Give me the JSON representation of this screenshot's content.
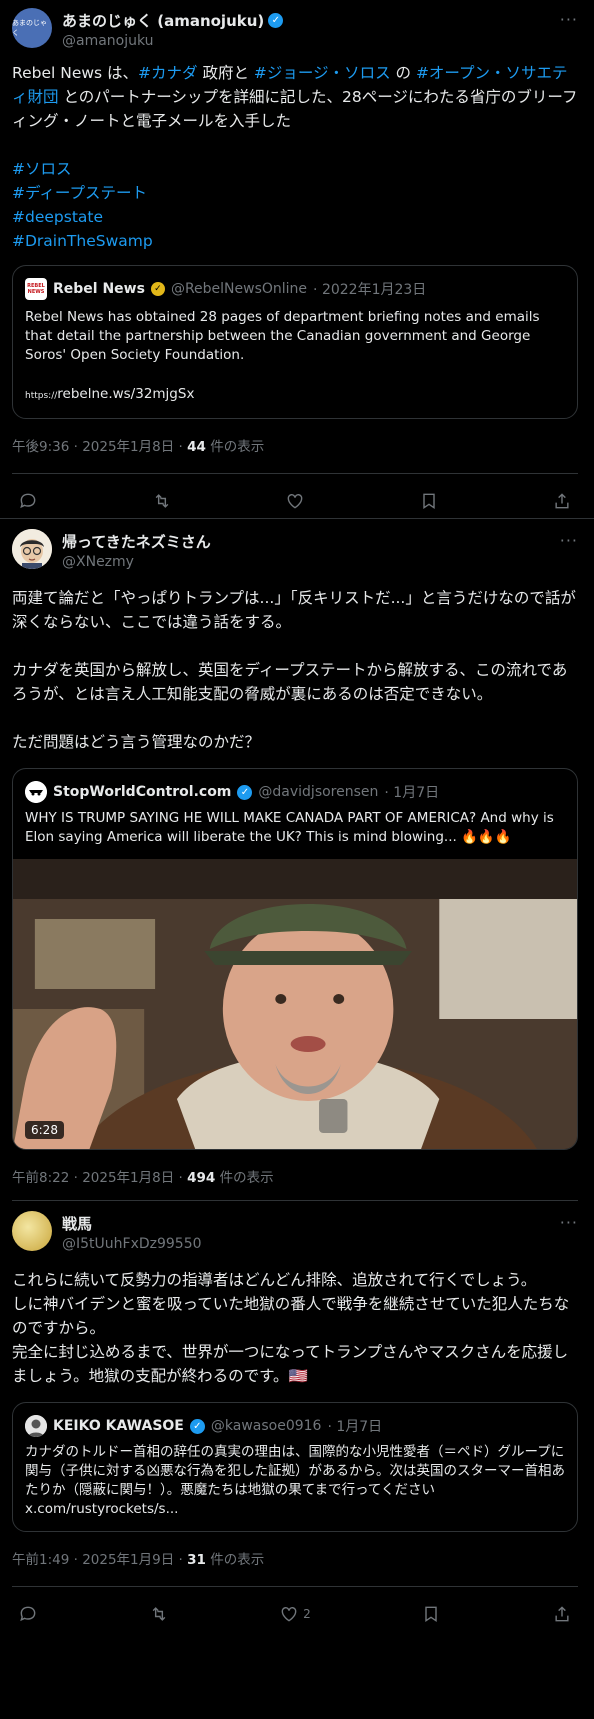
{
  "tweet1": {
    "display_name": "あまのじゅく (amanojuku)",
    "handle": "@amanojuku",
    "avatar_text": "あまのじゃく",
    "more": "···",
    "line1_a": "Rebel News は、",
    "tag_canada": "#カナダ",
    "line1_b": " 政府と ",
    "tag_soros": "#ジョージ・ソロス",
    "line1_c": " の ",
    "tag_osf": "#オープン・ソサエティ財団",
    "line1_d": " とのパートナーシップを詳細に記した、28ページにわたる省庁のブリーフィング・ノートと電子メールを入手した",
    "tags": [
      "#ソロス",
      "#ディープステート",
      "#deepstate",
      "#DrainTheSwamp"
    ],
    "quote": {
      "display_name": "Rebel News",
      "handle": "@RebelNewsOnline",
      "date": "· 2022年1月23日",
      "avatar_text": "REBEL NEWS",
      "text": "Rebel News has obtained 28 pages of department briefing notes and emails that detail the partnership between the Canadian government and George Soros' Open Society Foundation.",
      "link_prefix": "https://",
      "link": "rebelne.ws/32mjgSx"
    },
    "time": "午後9:36 · 2025年1月8日 · ",
    "views": "44",
    "views_suffix": " 件の表示"
  },
  "tweet2": {
    "display_name": "帰ってきたネズミさん",
    "handle": "@XNezmy",
    "more": "···",
    "p1": "両建て論だと「やっぱりトランプは...」「反キリストだ...」と言うだけなので話が深くならない、ここでは違う話をする。",
    "p2": "カナダを英国から解放し、英国をディープステートから解放する、この流れであろうが、とは言え人工知能支配の脅威が裏にあるのは否定できない。",
    "p3": "ただ問題はどう言う管理なのかだ？",
    "quote": {
      "display_name": "StopWorldControl.com",
      "handle": "@davidjsorensen",
      "date": "· 1月7日",
      "text": "WHY IS TRUMP SAYING HE WILL MAKE CANADA PART OF AMERICA? And why is Elon saying America will liberate the UK? This is mind blowing... 🔥🔥🔥",
      "duration": "6:28"
    },
    "time": "午前8:22 · 2025年1月8日 · ",
    "views": "494",
    "views_suffix": " 件の表示"
  },
  "tweet3": {
    "display_name": "戦馬",
    "handle": "@I5tUuhFxDz99550",
    "more": "···",
    "p1": "これらに続いて反勢力の指導者はどんどん排除、追放されて行くでしょう。",
    "p2": "しに神バイデンと蜜を吸っていた地獄の番人で戦争を継続させていた犯人たちなのですから。",
    "p3": "完全に封じ込めるまで、世界が一つになってトランプさんやマスクさんを応援しましょう。地獄の支配が終わるのです。🇺🇸",
    "quote": {
      "display_name": "KEIKO KAWASOE",
      "handle": "@kawasoe0916",
      "date": "· 1月7日",
      "text": "カナダのトルドー首相の辞任の真実の理由は、国際的な小児性愛者（＝ペド）グループに関与（子供に対する凶悪な行為を犯した証拠）があるから。次は英国のスターマー首相あたりか（隠蔽に関与！）。悪魔たちは地獄の果てまで行ってください x.com/rustyrockets/s..."
    },
    "time": "午前1:49 · 2025年1月9日 · ",
    "views": "31",
    "views_suffix": " 件の表示",
    "like_count": "2"
  },
  "colors": {
    "accent": "#1d9bf0",
    "muted": "#71767b",
    "border": "#2f3336",
    "bg": "#000000"
  },
  "icons": [
    "reply-icon",
    "retweet-icon",
    "like-icon",
    "bookmark-icon",
    "share-icon",
    "verified-icon"
  ]
}
